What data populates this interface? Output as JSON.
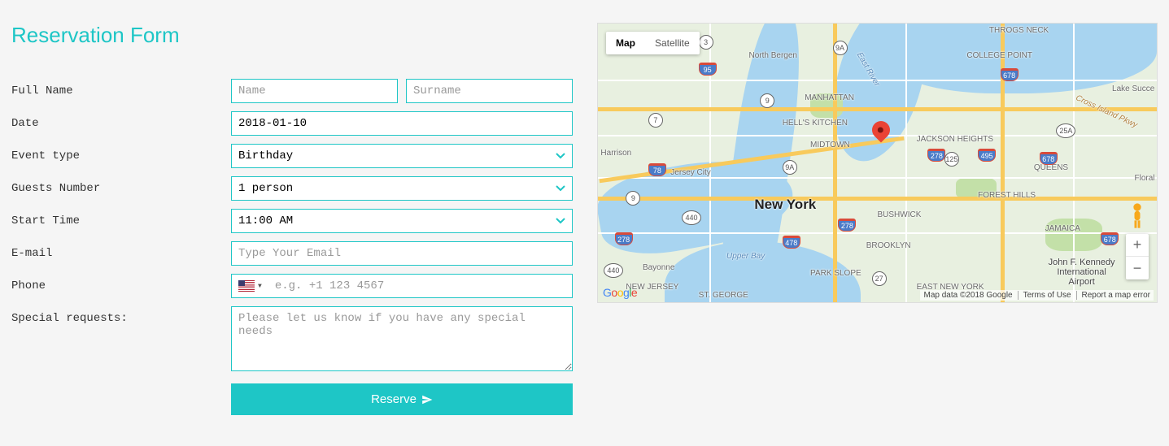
{
  "form": {
    "title": "Reservation Form",
    "labels": {
      "full_name": "Full Name",
      "date": "Date",
      "event_type": "Event type",
      "guests": "Guests Number",
      "start_time": "Start Time",
      "email": "E-mail",
      "phone": "Phone",
      "special": "Special requests:"
    },
    "placeholders": {
      "name": "Name",
      "surname": "Surname",
      "email": "Type Your Email",
      "phone": "e.g. +1 123 4567",
      "special": "Please let us know if you have any special needs"
    },
    "values": {
      "date": "2018-01-10",
      "event_type": "Birthday",
      "guests": "1 person",
      "start_time": "11:00 AM"
    },
    "button": "Reserve"
  },
  "map": {
    "type_map": "Map",
    "type_sat": "Satellite",
    "center": "New York",
    "labels": {
      "north_bergen": "North Bergen",
      "manhattan": "MANHATTAN",
      "hells_kitchen": "HELL'S KITCHEN",
      "midtown": "MIDTOWN",
      "jersey_city": "Jersey City",
      "harrison": "Harrison",
      "brooklyn": "BROOKLYN",
      "bayonne": "Bayonne",
      "queens": "QUEENS",
      "jackson_heights": "JACKSON HEIGHTS",
      "college_point": "COLLEGE POINT",
      "throgs_neck": "THROGS NECK",
      "bushwick": "BUSHWICK",
      "park_slope": "PARK SLOPE",
      "forest_hills": "FOREST HILLS",
      "jamaica": "JAMAICA",
      "floral": "Floral",
      "lake_succ": "Lake Succe",
      "new_jersey": "NEW JERSEY",
      "east_ny": "EAST NEW YORK",
      "upper_bay": "Upper Bay",
      "st_george": "ST. GEORGE",
      "east_river": "East River",
      "cross_island": "Cross Island Pkwy",
      "jfk": "John F. Kennedy International Airport"
    },
    "hwy": {
      "i95": "95",
      "i78": "78",
      "i278a": "278",
      "i278b": "278",
      "i278c": "278",
      "i495": "495",
      "i678a": "678",
      "i678b": "678",
      "i678c": "678",
      "i478": "478"
    },
    "routes": {
      "r7": "7",
      "r3": "3",
      "r9a": "9",
      "r9b": "9",
      "r440": "440",
      "r440b": "440",
      "r9A": "9A",
      "r9A2": "9A",
      "r125": "125",
      "r25a": "25A",
      "r27": "27"
    },
    "logo": "Google",
    "footer": {
      "copyright": "Map data ©2018 Google",
      "terms": "Terms of Use",
      "report": "Report a map error"
    }
  }
}
